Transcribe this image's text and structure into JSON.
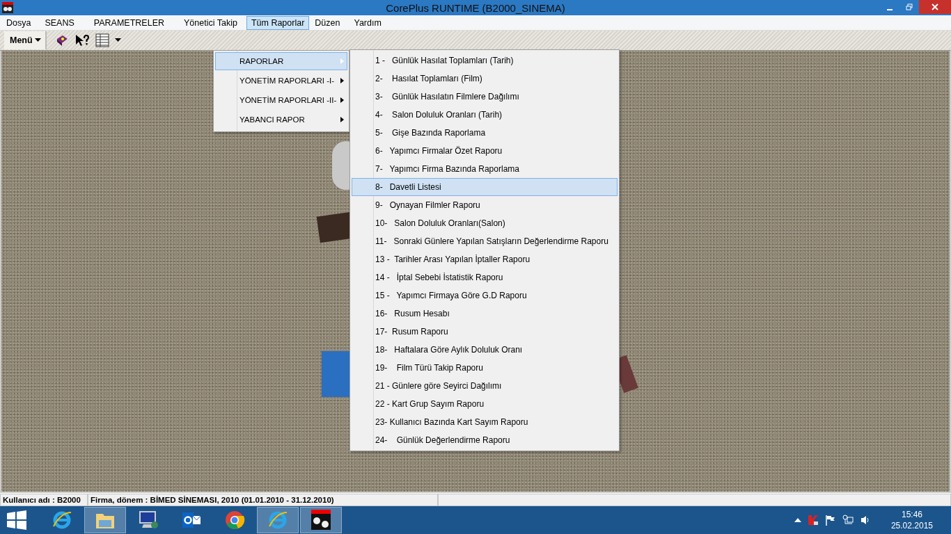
{
  "window": {
    "title": "CorePlus RUNTIME (B2000_SINEMA)"
  },
  "menu_bar": [
    {
      "label": "Dosya",
      "selected": false
    },
    {
      "label": "SEANS",
      "selected": false
    },
    {
      "label": "PARAMETRELER",
      "selected": false
    },
    {
      "label": "Yönetici Takip",
      "selected": false
    },
    {
      "label": "Tüm Raporlar",
      "selected": true
    },
    {
      "label": "Düzen",
      "selected": false
    },
    {
      "label": "Yardım",
      "selected": false
    }
  ],
  "toolbar": {
    "menu_button": "Menü"
  },
  "reports_menu": [
    {
      "label": "RAPORLAR",
      "selected": true
    },
    {
      "label": "YÖNETİM RAPORLARI -I-",
      "selected": false
    },
    {
      "label": "YÖNETİM RAPORLARI -II-",
      "selected": false
    },
    {
      "label": "YABANCI RAPOR",
      "selected": false
    }
  ],
  "report_list": [
    {
      "label": "1 -   Günlük Hasılat Toplamları (Tarih)",
      "selected": false
    },
    {
      "label": "2-    Hasılat Toplamları (Film)",
      "selected": false
    },
    {
      "label": "3-    Günlük Hasılatın Filmlere Dağılımı",
      "selected": false
    },
    {
      "label": "4-    Salon Doluluk Oranları (Tarih)",
      "selected": false
    },
    {
      "label": "5-    Gişe Bazında Raporlama",
      "selected": false
    },
    {
      "label": "6-   Yapımcı Firmalar Özet Raporu",
      "selected": false
    },
    {
      "label": "7-   Yapımcı Firma Bazında Raporlama",
      "selected": false
    },
    {
      "label": "8-   Davetli Listesi",
      "selected": true
    },
    {
      "label": "9-   Oynayan Filmler Raporu",
      "selected": false
    },
    {
      "label": "10-   Salon Doluluk Oranları(Salon)",
      "selected": false
    },
    {
      "label": "11-   Sonraki Günlere Yapılan Satışların Değerlendirme Raporu",
      "selected": false
    },
    {
      "label": "13 -  Tarihler Arası Yapılan İptaller Raporu",
      "selected": false
    },
    {
      "label": "14 -   İptal Sebebi İstatistik Raporu",
      "selected": false
    },
    {
      "label": "15 -   Yapımcı Firmaya Göre G.D Raporu",
      "selected": false
    },
    {
      "label": "16-   Rusum Hesabı",
      "selected": false
    },
    {
      "label": "17-  Rusum Raporu",
      "selected": false
    },
    {
      "label": "18-   Haftalara Göre Aylık Doluluk Oranı",
      "selected": false
    },
    {
      "label": "19-    Film Türü Takip Raporu",
      "selected": false
    },
    {
      "label": "21 - Günlere göre Seyirci Dağılımı",
      "selected": false
    },
    {
      "label": "22 - Kart Grup Sayım Raporu",
      "selected": false
    },
    {
      "label": "23- Kullanıcı Bazında Kart Sayım Raporu",
      "selected": false
    },
    {
      "label": "24-    Günlük Değerlendirme Raporu",
      "selected": false
    }
  ],
  "status_bar": {
    "user": "Kullanıcı adı : B2000",
    "company": "Firma, dönem : BİMED SİNEMASI, 2010 (01.01.2010 - 31.12.2010)"
  },
  "taskbar": {
    "apps": [
      {
        "kind": "ie",
        "active": false
      },
      {
        "kind": "explorer",
        "active": true
      },
      {
        "kind": "remote",
        "active": false
      },
      {
        "kind": "outlook",
        "active": false
      },
      {
        "kind": "chrome",
        "active": false
      },
      {
        "kind": "ie",
        "active": true
      },
      {
        "kind": "app",
        "active": true
      }
    ],
    "time": "15:46",
    "date": "25.02.2015"
  }
}
